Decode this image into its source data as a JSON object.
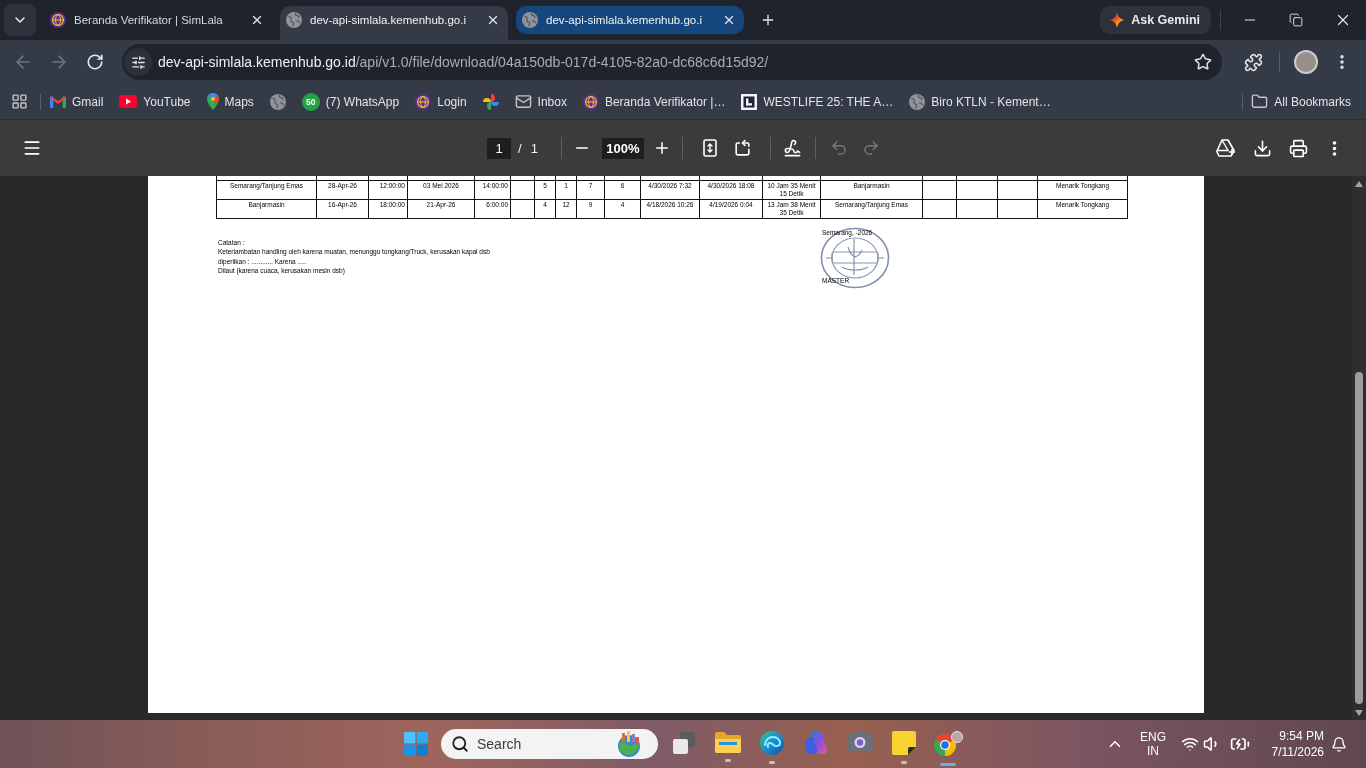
{
  "browser": {
    "tabs": [
      {
        "kind": "logo",
        "title": "Beranda Verifikator | SimLala",
        "selected": false,
        "highlighted": false
      },
      {
        "kind": "globe",
        "title": "dev-api-simlala.kemenhub.go.i",
        "selected": true,
        "highlighted": false
      },
      {
        "kind": "globe",
        "title": "dev-api-simlala.kemenhub.go.i",
        "selected": false,
        "highlighted": true
      }
    ],
    "gemini_button": "Ask Gemini",
    "navigation": {
      "back": {
        "disabled": true
      },
      "forward": {
        "disabled": true
      }
    },
    "address_bar": {
      "host": "dev-api-simlala.kemenhub.go.id",
      "path": "/api/v1.0/file/download/04a150db-017d-4105-82a0-dc68c6d15d92/"
    },
    "bookmarks": [
      {
        "kind": "gmail",
        "label": "Gmail"
      },
      {
        "kind": "youtube",
        "label": "YouTube"
      },
      {
        "kind": "maps",
        "label": "Maps"
      },
      {
        "kind": "globe"
      },
      {
        "kind": "whatsapp",
        "badge": "50",
        "label": "(7) WhatsApp"
      },
      {
        "kind": "logo",
        "label": "Login"
      },
      {
        "kind": "photos"
      },
      {
        "kind": "mail",
        "label": "Inbox"
      },
      {
        "kind": "logo",
        "label": "Beranda Verifikator |…"
      },
      {
        "kind": "square-logo",
        "label": "WESTLIFE 25: THE A…"
      },
      {
        "kind": "globe",
        "label": "Biro KTLN - Kement…"
      }
    ],
    "all_bookmarks": "All Bookmarks"
  },
  "pdf_viewer": {
    "toolbar": {
      "page": "1",
      "separator": "/",
      "page_count": "1",
      "zoom": "100%",
      "undo": {
        "disabled": true
      },
      "redo": {
        "disabled": true
      }
    },
    "document": {
      "table": {
        "rows": [
          {
            "cells": [
              "Semarang/Tanjung Emas",
              "28-Apr-26",
              "12:00:00",
              "03 Mei 2026",
              "14:00:00",
              null,
              "5",
              "1",
              "7",
              "6",
              "4/30/2026 7:32",
              "4/30/2026 18:08",
              "10 Jam 35 Menit 15 Detik",
              "Banjarmasin",
              null,
              null,
              null,
              "Menarik Tongkang"
            ]
          },
          {
            "cells": [
              "Banjarmasin",
              "16-Apr-26",
              "18:00:00",
              "21-Apr-26",
              "6:00:00",
              null,
              "4",
              "12",
              "9",
              "4",
              "4/18/2026 10:26",
              "4/19/2026 0:04",
              "13 Jam 38 Menit 35 Detik",
              "Semarang/Tanjung Emas",
              null,
              null,
              null,
              "Menarik Tongkang"
            ]
          }
        ]
      },
      "notes": {
        "heading": "Catatan :",
        "lines": [
          "Keterlambatan handling oleh karena muatan, menunggu tongkang/Truck, kerusakan kapal dsb",
          "diperlikan : ............ Karena .....",
          "Dilaut (karena cuaca, kerusakan mesin dsb)"
        ]
      },
      "signature": {
        "place_date": "Semarang, -2026",
        "title": "MASTER"
      }
    }
  },
  "taskbar": {
    "search": {
      "placeholder": "Search"
    },
    "apps": [
      {
        "kind": "task-view",
        "running": false,
        "active": false
      },
      {
        "kind": "explorer",
        "running": true,
        "active": false
      },
      {
        "kind": "edge",
        "running": true,
        "active": false
      },
      {
        "kind": "copilot",
        "running": false,
        "active": false
      },
      {
        "kind": "camera",
        "running": false,
        "active": false
      },
      {
        "kind": "sticky-notes",
        "running": true,
        "active": false
      },
      {
        "kind": "chrome",
        "running": true,
        "active": true
      }
    ],
    "language": {
      "code": "ENG",
      "region": "IN"
    },
    "time": "9:54 PM",
    "date": "7/11/2026"
  }
}
